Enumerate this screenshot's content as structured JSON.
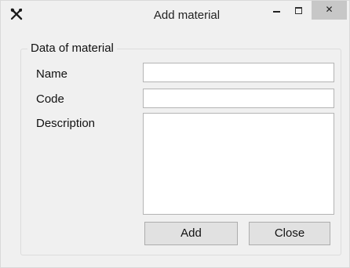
{
  "window": {
    "title": "Add material",
    "controls": {
      "minimize_icon": "minimize-icon",
      "maximize_icon": "maximize-icon",
      "close_label": "✕"
    },
    "app_icon": "tools-icon"
  },
  "group": {
    "legend": "Data of material",
    "fields": {
      "name_label": "Name",
      "name_value": "",
      "code_label": "Code",
      "code_value": "",
      "description_label": "Description",
      "description_value": ""
    }
  },
  "buttons": {
    "add_label": "Add",
    "close_label": "Close"
  },
  "colors": {
    "window_bg": "#f0f0f0",
    "close_button_bg": "#c7c7c7",
    "button_bg": "#e1e1e1",
    "input_border": "#b4b4b4"
  }
}
